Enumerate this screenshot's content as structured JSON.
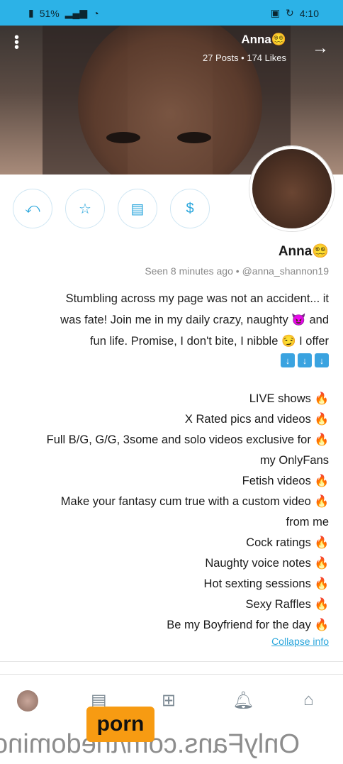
{
  "status_bar": {
    "time": "4:10",
    "battery": "51%"
  },
  "cover": {
    "name": "Anna😵‍💫",
    "stats": "27 Posts • 174 Likes"
  },
  "profile": {
    "name": "Anna😵‍💫",
    "handle": "@anna_shannon19",
    "seen": "Seen 8 minutes ago"
  },
  "bio": {
    "lines": [
      "Stumbling across my page was not an accident... it",
      "was fate! Join me in my daily crazy, naughty 😈 and",
      "fun life. Promise, I don't bite, I nibble 😏 I offer"
    ]
  },
  "offer_items": [
    "LIVE shows",
    "X Rated pics and videos",
    "Full B/G, G/G, 3some and solo videos exclusive for",
    "my OnlyFans",
    "Fetish videos",
    "Make your fantasy cum true with a custom video",
    "from me",
    "Cock ratings",
    "Naughty voice notes",
    "Hot sexting sessions",
    "Sexy Raffles",
    "Be my Boyfriend for the day"
  ],
  "collapse_label": "Collapse info",
  "watermark": "OnlyFans.com/thedomino",
  "logo_text": "porn",
  "colors": {
    "accent": "#2aa6dc",
    "status_bar": "#2cb2e7"
  }
}
